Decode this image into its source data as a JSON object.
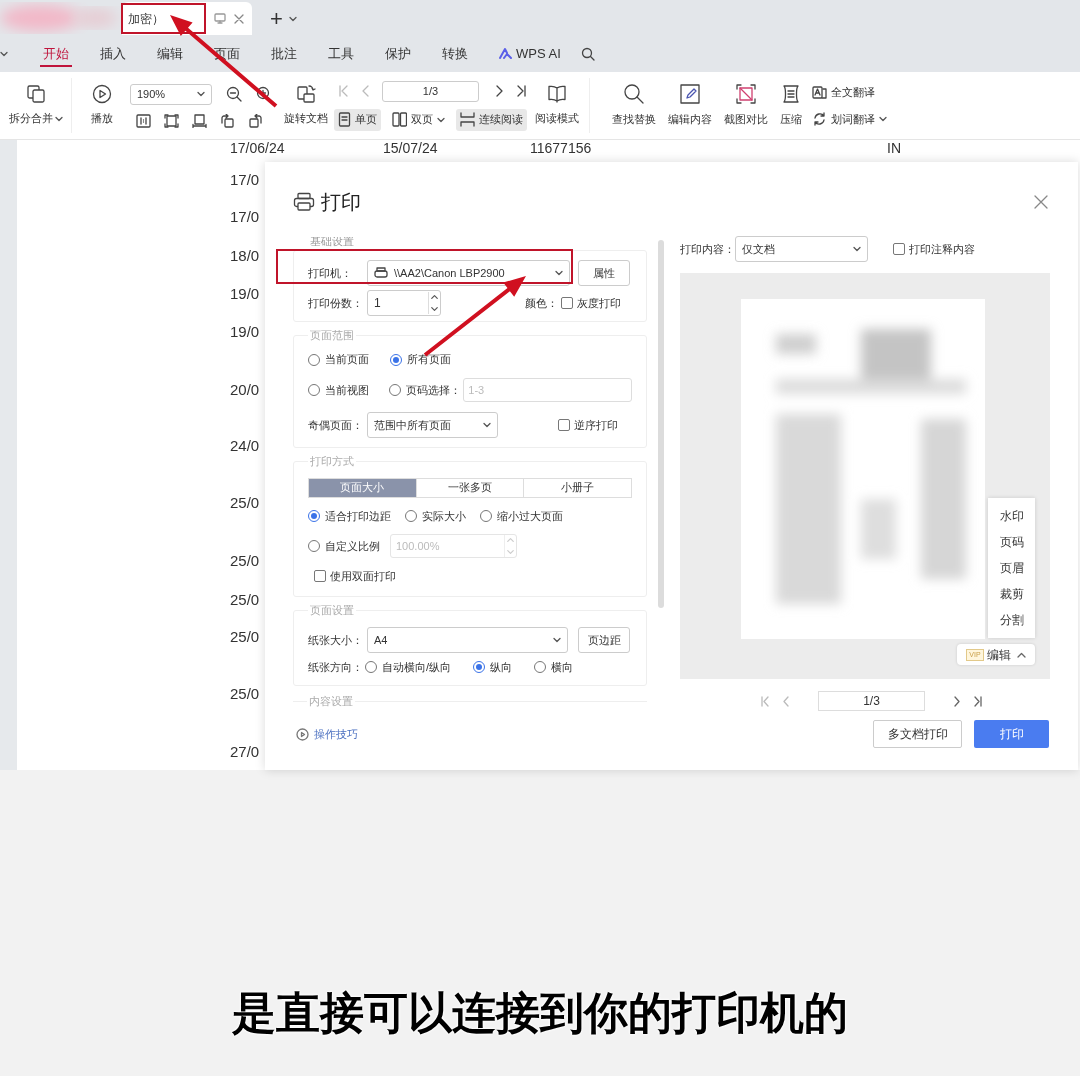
{
  "tabbar": {
    "doc_title": "加密）",
    "new_tab": "+"
  },
  "ribbon_tabs": [
    {
      "label": "开始",
      "selected": true
    },
    {
      "label": "插入",
      "selected": false
    },
    {
      "label": "编辑",
      "selected": false
    },
    {
      "label": "页面",
      "selected": false
    },
    {
      "label": "批注",
      "selected": false
    },
    {
      "label": "工具",
      "selected": false
    },
    {
      "label": "保护",
      "selected": false
    },
    {
      "label": "转换",
      "selected": false
    },
    {
      "label": "WPS AI",
      "selected": false
    }
  ],
  "toolbar": {
    "split_merge": "拆分合并",
    "play": "播放",
    "zoom": "190%",
    "rotate": "旋转文档",
    "page": "1/3",
    "views": [
      {
        "label": "单页",
        "selected": true,
        "kind": "single"
      },
      {
        "label": "双页",
        "selected": false,
        "kind": "double"
      },
      {
        "label": "连续阅读",
        "selected": true,
        "kind": "continuous"
      }
    ],
    "reading_mode": "阅读模式",
    "tools": [
      "查找替换",
      "编辑内容",
      "截图对比",
      "压缩"
    ],
    "full_translate": "全文翻译",
    "word_translate": "划词翻译"
  },
  "document": {
    "top_row": [
      "17/06/24",
      "15/07/24",
      "11677156",
      "IN"
    ],
    "dates": [
      "17/0",
      "17/0",
      "18/0",
      "19/0",
      "19/0",
      "20/0",
      "24/0",
      "25/0",
      "25/0",
      "25/0",
      "25/0",
      "25/0",
      "27/0"
    ]
  },
  "print_dialog": {
    "title": "打印",
    "basic": {
      "legend": "基础设置",
      "printer_label": "打印机：",
      "printer": "\\\\AA2\\Canon LBP2900",
      "properties_button": "属性",
      "copies_label": "打印份数：",
      "copies": "1",
      "color_label": "颜色：",
      "grayscale": {
        "label": "灰度打印",
        "checked": false
      }
    },
    "range": {
      "legend": "页面范围",
      "options": [
        {
          "label": "当前页面",
          "selected": false
        },
        {
          "label": "所有页面",
          "selected": true
        },
        {
          "label": "当前视图",
          "selected": false
        },
        {
          "label": "页码选择：",
          "selected": false
        }
      ],
      "pages_placeholder": "1-3",
      "odd_even_label": "奇偶页面：",
      "odd_even": "范围中所有页面",
      "reverse": {
        "label": "逆序打印",
        "checked": false
      }
    },
    "mode": {
      "legend": "打印方式",
      "tabs": [
        {
          "label": "页面大小",
          "selected": true
        },
        {
          "label": "一张多页",
          "selected": false
        },
        {
          "label": "小册子",
          "selected": false
        }
      ],
      "scale_options": [
        {
          "label": "适合打印边距",
          "selected": true
        },
        {
          "label": "实际大小",
          "selected": false
        },
        {
          "label": "缩小过大页面",
          "selected": false
        },
        {
          "label": "自定义比例",
          "selected": false
        }
      ],
      "custom_scale": "100.00%",
      "duplex": {
        "label": "使用双面打印",
        "checked": false
      }
    },
    "page_setup": {
      "legend": "页面设置",
      "paper_label": "纸张大小：",
      "paper": "A4",
      "margins_button": "页边距",
      "orientation_label": "纸张方向：",
      "orientations": [
        {
          "label": "自动横向/纵向",
          "selected": false
        },
        {
          "label": "纵向",
          "selected": true
        },
        {
          "label": "横向",
          "selected": false
        }
      ]
    },
    "content_legend": "内容设置",
    "tips_link": "操作技巧",
    "preview": {
      "content_label": "打印内容：",
      "content": "仅文档",
      "annotations": {
        "label": "打印注释内容",
        "checked": false
      },
      "edit_menu": [
        "水印",
        "页码",
        "页眉",
        "裁剪",
        "分割"
      ],
      "vip_badge": "VIP",
      "edit_button": "编辑",
      "page": "1/3"
    },
    "buttons": [
      {
        "label": "多文档打印",
        "kind": "secondary"
      },
      {
        "label": "打印",
        "kind": "primary"
      }
    ]
  },
  "subtitle": "是直接可以连接到你的打印机的"
}
